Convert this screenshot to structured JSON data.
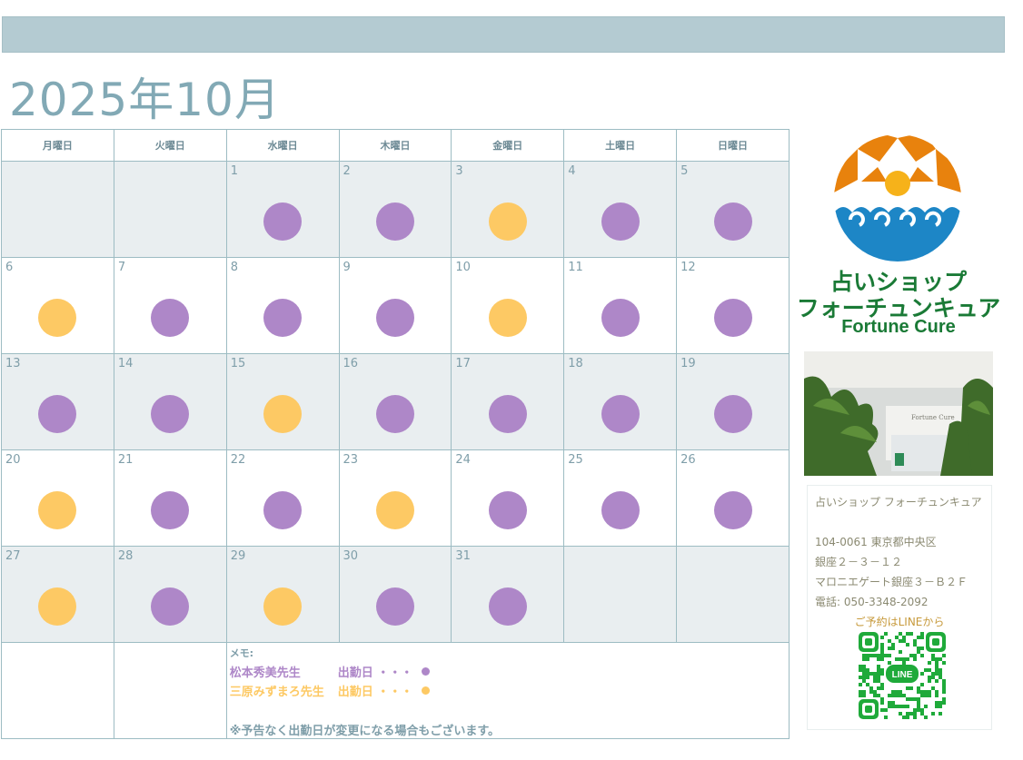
{
  "header": {
    "month_title": "2025年10月"
  },
  "calendar": {
    "weekdays": [
      "月曜日",
      "火曜日",
      "水曜日",
      "木曜日",
      "金曜日",
      "土曜日",
      "日曜日"
    ],
    "weeks": [
      [
        {
          "day": "",
          "mark": ""
        },
        {
          "day": "",
          "mark": ""
        },
        {
          "day": "1",
          "mark": "purple"
        },
        {
          "day": "2",
          "mark": "purple"
        },
        {
          "day": "3",
          "mark": "yellow"
        },
        {
          "day": "4",
          "mark": "purple"
        },
        {
          "day": "5",
          "mark": "purple"
        }
      ],
      [
        {
          "day": "6",
          "mark": "yellow"
        },
        {
          "day": "7",
          "mark": "purple"
        },
        {
          "day": "8",
          "mark": "purple"
        },
        {
          "day": "9",
          "mark": "purple"
        },
        {
          "day": "10",
          "mark": "yellow"
        },
        {
          "day": "11",
          "mark": "purple"
        },
        {
          "day": "12",
          "mark": "purple"
        }
      ],
      [
        {
          "day": "13",
          "mark": "purple"
        },
        {
          "day": "14",
          "mark": "purple"
        },
        {
          "day": "15",
          "mark": "yellow"
        },
        {
          "day": "16",
          "mark": "purple"
        },
        {
          "day": "17",
          "mark": "purple"
        },
        {
          "day": "18",
          "mark": "purple"
        },
        {
          "day": "19",
          "mark": "purple"
        }
      ],
      [
        {
          "day": "20",
          "mark": "yellow"
        },
        {
          "day": "21",
          "mark": "purple"
        },
        {
          "day": "22",
          "mark": "purple"
        },
        {
          "day": "23",
          "mark": "yellow"
        },
        {
          "day": "24",
          "mark": "purple"
        },
        {
          "day": "25",
          "mark": "purple"
        },
        {
          "day": "26",
          "mark": "purple"
        }
      ],
      [
        {
          "day": "27",
          "mark": "yellow"
        },
        {
          "day": "28",
          "mark": "purple"
        },
        {
          "day": "29",
          "mark": "yellow"
        },
        {
          "day": "30",
          "mark": "purple"
        },
        {
          "day": "31",
          "mark": "purple"
        },
        {
          "day": "",
          "mark": ""
        },
        {
          "day": "",
          "mark": ""
        }
      ]
    ]
  },
  "memo": {
    "label": "メモ:",
    "line1_name": "松本秀美先生",
    "line1_text": "出勤日 ・・・",
    "line2_name": "三原みずまろ先生",
    "line2_text": "出勤日 ・・・",
    "note": "※予告なく出勤日が変更になる場合もございます。"
  },
  "shop": {
    "name_line1": "占いショップ",
    "name_line2": "フォーチュンキュア",
    "name_en": "Fortune Cure",
    "photo_sign": "Fortune Cure",
    "info_name": "占いショップ フォーチュンキュア",
    "postal": "104-0061 東京都中央区",
    "address1": "銀座２－３－１２",
    "address2": "マロニエゲート銀座３－Ｂ２Ｆ",
    "phone": "電話: 050-3348-2092",
    "cta": "ご予約はLINEから",
    "qr_label": "LINE"
  },
  "colors": {
    "purple": "#ae87c8",
    "yellow": "#fdc964",
    "header_bar": "#b4cbd2",
    "title": "#82a9b5",
    "shade": "#e9eef0",
    "brand_green": "#1a7a36",
    "logo_orange": "#e8820d",
    "logo_blue": "#1d86c6"
  }
}
